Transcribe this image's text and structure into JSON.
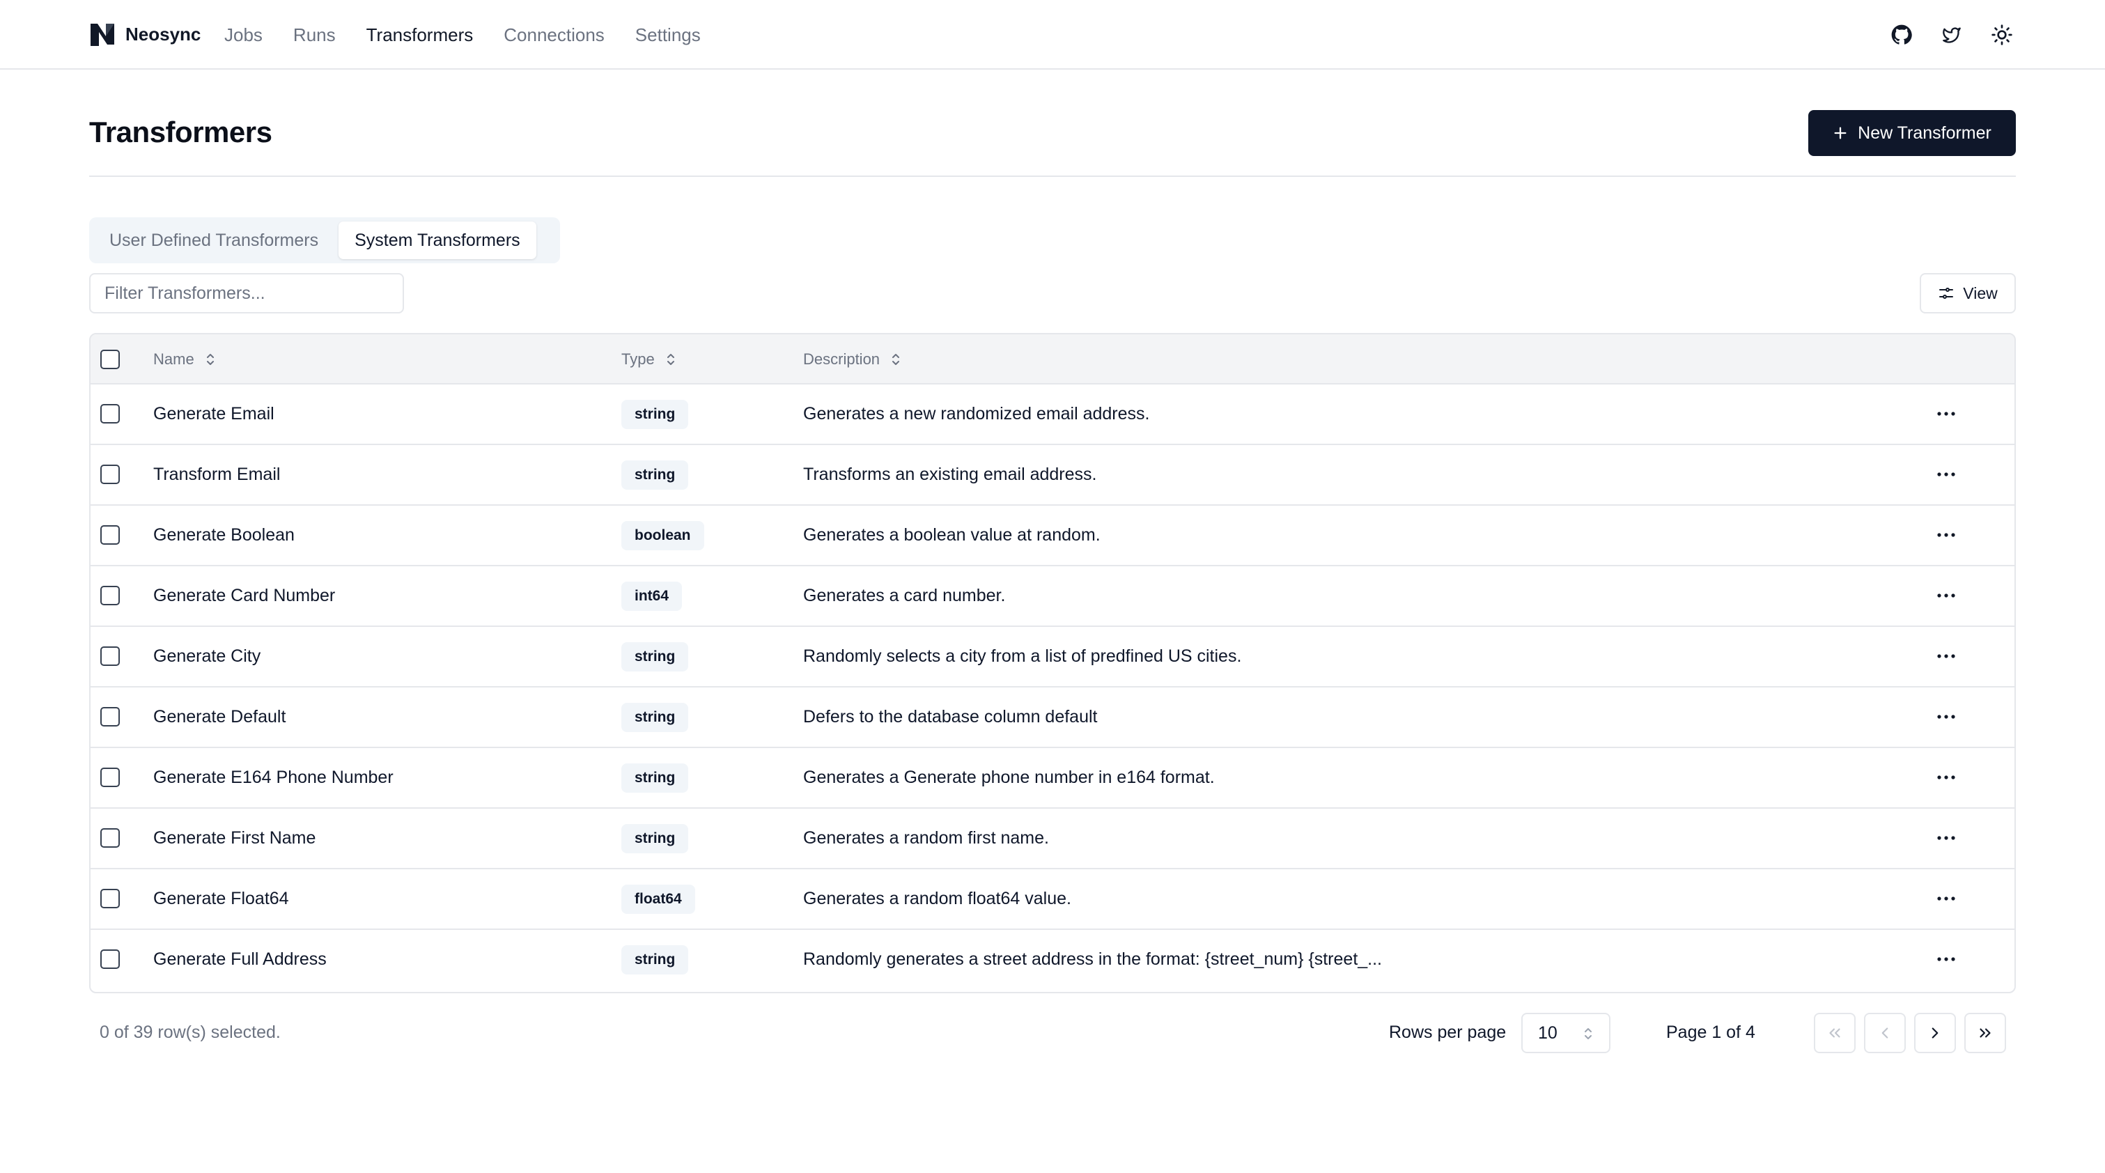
{
  "brand": {
    "name": "Neosync"
  },
  "nav": [
    {
      "label": "Jobs",
      "active": false
    },
    {
      "label": "Runs",
      "active": false
    },
    {
      "label": "Transformers",
      "active": true
    },
    {
      "label": "Connections",
      "active": false
    },
    {
      "label": "Settings",
      "active": false
    }
  ],
  "header_icons": [
    "github-icon",
    "twitter-icon",
    "sun-icon"
  ],
  "page": {
    "title": "Transformers",
    "new_button": "New Transformer"
  },
  "tabs": [
    {
      "label": "User Defined Transformers",
      "active": false
    },
    {
      "label": "System Transformers",
      "active": true
    }
  ],
  "filter": {
    "placeholder": "Filter Transformers...",
    "value": ""
  },
  "view_button": "View",
  "table": {
    "columns": [
      "Name",
      "Type",
      "Description"
    ],
    "rows": [
      {
        "name": "Generate Email",
        "type": "string",
        "description": "Generates a new randomized email address."
      },
      {
        "name": "Transform Email",
        "type": "string",
        "description": "Transforms an existing email address."
      },
      {
        "name": "Generate Boolean",
        "type": "boolean",
        "description": "Generates a boolean value at random."
      },
      {
        "name": "Generate Card Number",
        "type": "int64",
        "description": "Generates a card number."
      },
      {
        "name": "Generate City",
        "type": "string",
        "description": "Randomly selects a city from a list of predfined US cities."
      },
      {
        "name": "Generate Default",
        "type": "string",
        "description": "Defers to the database column default"
      },
      {
        "name": "Generate E164 Phone Number",
        "type": "string",
        "description": "Generates a Generate phone number in e164 format."
      },
      {
        "name": "Generate First Name",
        "type": "string",
        "description": "Generates a random first name."
      },
      {
        "name": "Generate Float64",
        "type": "float64",
        "description": "Generates a random float64 value."
      },
      {
        "name": "Generate Full Address",
        "type": "string",
        "description": "Randomly generates a street address in the format: {street_num} {street_..."
      }
    ]
  },
  "footer": {
    "selected": "0 of 39 row(s) selected.",
    "rows_per_page_label": "Rows per page",
    "rows_per_page_value": "10",
    "page_info": "Page 1 of 4"
  },
  "colors": {
    "primary": "#0f172a",
    "muted": "#6b7280",
    "border": "#e5e7eb",
    "header_bg": "#f3f4f6"
  }
}
